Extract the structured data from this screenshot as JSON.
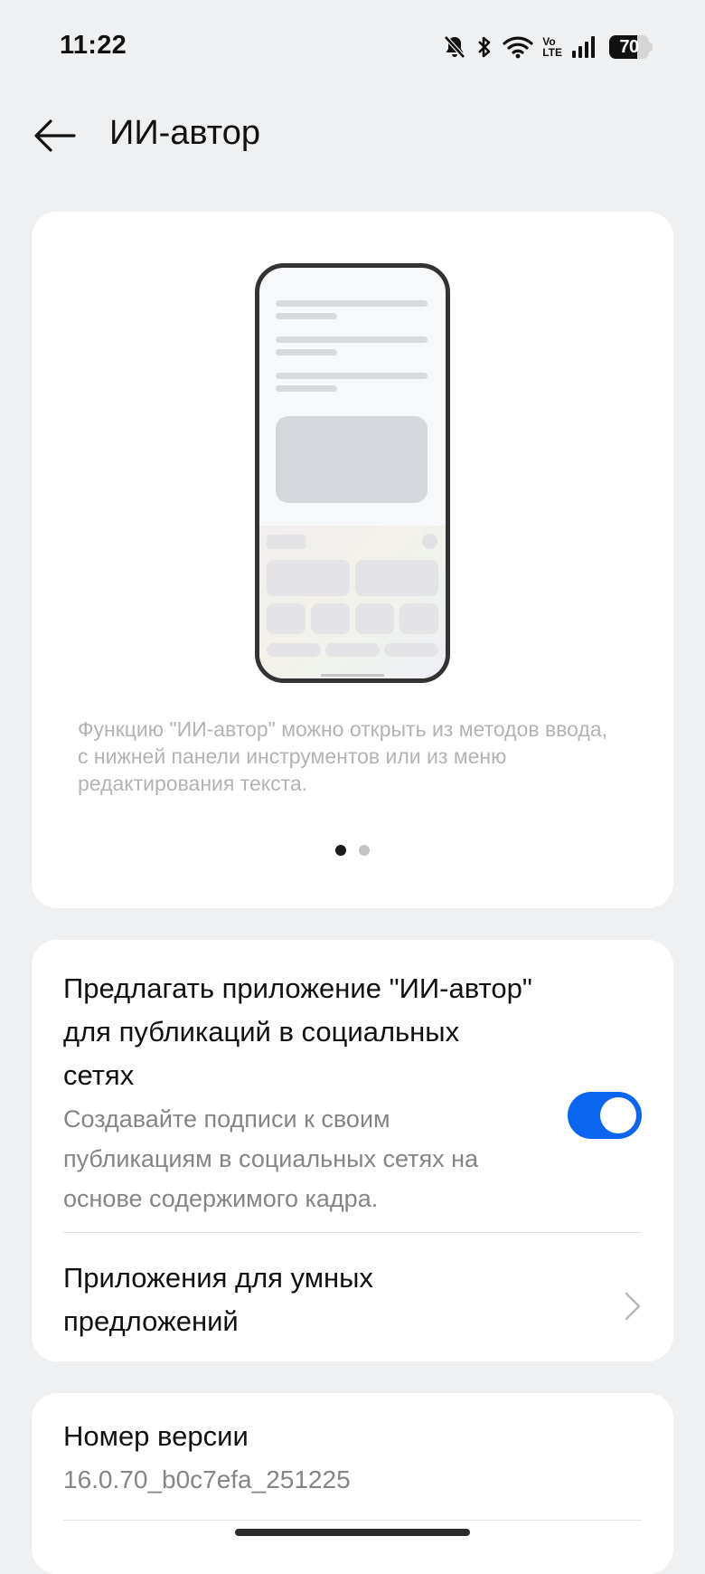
{
  "status_bar": {
    "time": "11:22",
    "battery": "70",
    "battery_level": 0.7,
    "icons": [
      "bell-off-icon",
      "bluetooth-icon",
      "wifi-icon",
      "volte-icon",
      "signal-icon",
      "battery-icon"
    ],
    "volte_top": "Vo",
    "volte_bottom": "LTE"
  },
  "header": {
    "back_icon": "arrow-left-icon",
    "title": "ИИ-автор"
  },
  "illustration": {
    "caption": "Функцию \"ИИ-автор\" можно открыть из методов ввода, с нижней панели инструментов или из меню редактирования текста.",
    "pager_total": 2,
    "pager_active": 1
  },
  "settings": {
    "suggest_title": "Предлагать приложение \"ИИ-автор\" для публикаций в социальных сетях",
    "suggest_desc": "Создавайте подписи к своим публикациям в социальных сетях на основе содержимого кадра.",
    "suggest_enabled": true,
    "smart_apps_title": "Приложения для умных предложений",
    "chevron_icon": "chevron-right-icon"
  },
  "version": {
    "title": "Номер версии",
    "value": "16.0.70_b0c7efa_251225"
  },
  "colors": {
    "accent": "#0a66f0",
    "background": "#eff0f2",
    "card": "#ffffff"
  }
}
